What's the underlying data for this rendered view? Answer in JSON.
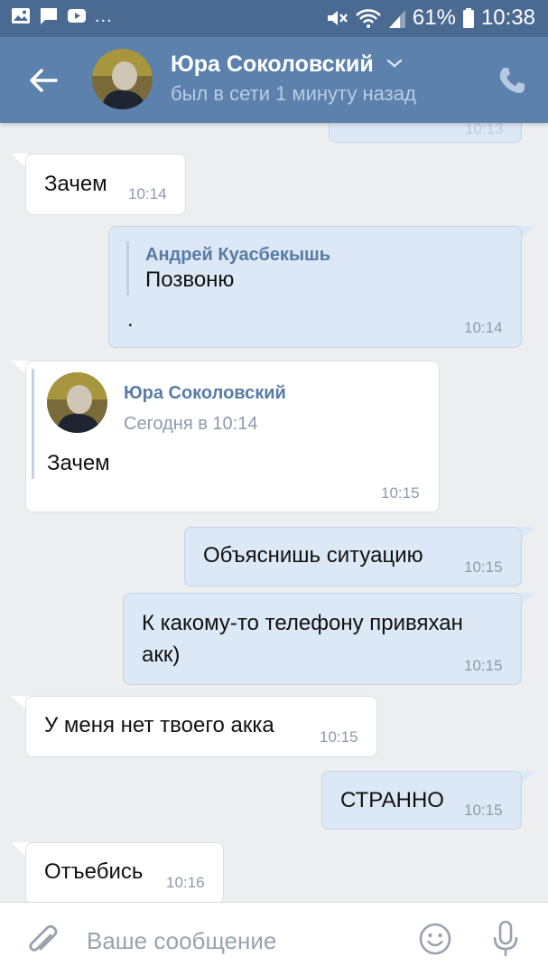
{
  "status_bar": {
    "left_icons": [
      "image-icon",
      "chat-icon",
      "youtube-icon"
    ],
    "more": "...",
    "battery": "61%",
    "time": "10:38"
  },
  "header": {
    "name": "Юра Соколовский",
    "status": "был в сети 1 минуту назад"
  },
  "messages": [
    {
      "dir": "out",
      "time": "10:13"
    },
    {
      "dir": "in",
      "text": "Зачем",
      "time": "10:14"
    },
    {
      "dir": "out",
      "reply_name": "Андрей Куасбекышь",
      "reply_text": "Позвоню",
      "text": ".",
      "time": "10:14"
    },
    {
      "dir": "in",
      "forward_name": "Юра Соколовский",
      "forward_date": "Сегодня в 10:14",
      "text": "Зачем",
      "time": "10:15"
    },
    {
      "dir": "out",
      "text": "Объяснишь ситуацию",
      "time": "10:15"
    },
    {
      "dir": "out",
      "text_line1": "К какому-то телефону привяхан",
      "text_line2": "акк)",
      "time": "10:15"
    },
    {
      "dir": "in",
      "text": "У меня нет твоего акка",
      "time": "10:15"
    },
    {
      "dir": "out",
      "text": "СТРАННО",
      "time": "10:15"
    },
    {
      "dir": "in",
      "text": "Отъебись",
      "time": "10:16"
    }
  ],
  "composer": {
    "placeholder": "Ваше сообщение"
  },
  "colors": {
    "statusbar": "#4a6a92",
    "header": "#5b81ac",
    "background": "#edeef0",
    "incoming": "#ffffff",
    "outgoing": "#dde8f6",
    "accent_text": "#577ca5"
  }
}
